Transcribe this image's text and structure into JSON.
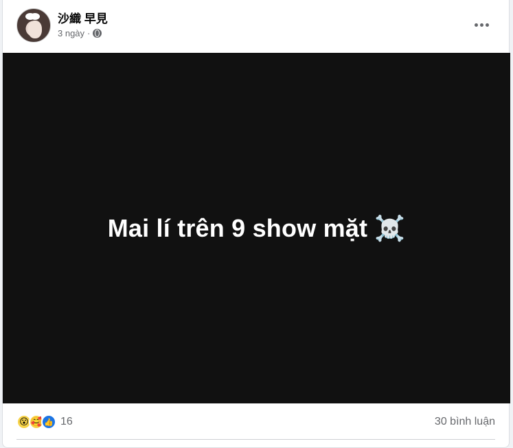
{
  "post": {
    "author": "沙織 早見",
    "time": "3 ngày",
    "separator": "·",
    "privacy_icon": "globe-icon",
    "more_icon": "more-horizontal-icon",
    "media": {
      "text": "Mai lí trên 9 show mặt",
      "emoji": "☠️",
      "background": "#111111"
    },
    "reactions": {
      "icons": [
        "wow-icon",
        "care-icon",
        "like-icon"
      ],
      "count": "16"
    },
    "comments_label": "30 bình luận"
  },
  "colors": {
    "text_primary": "#050505",
    "text_secondary": "#65676b",
    "like_blue": "#1b74e4",
    "divider": "#ced0d4"
  }
}
